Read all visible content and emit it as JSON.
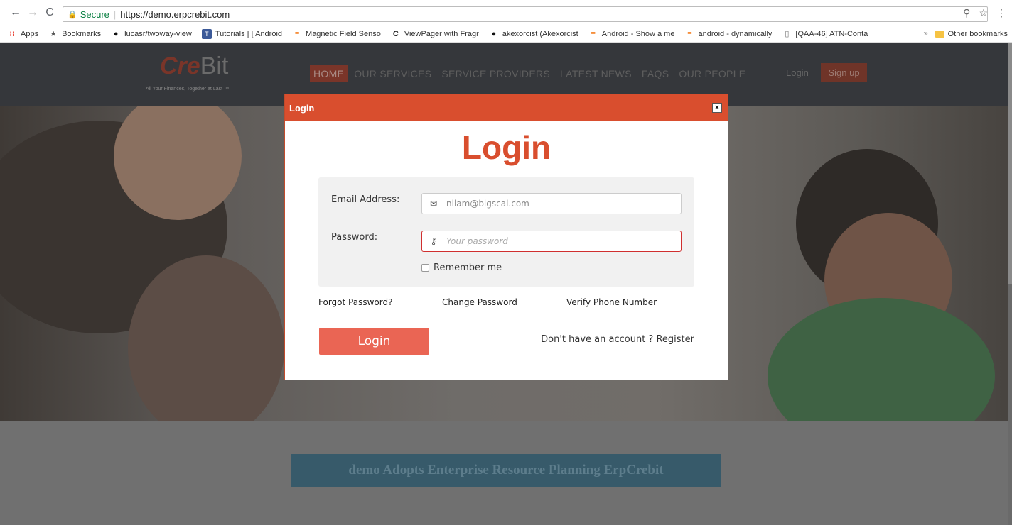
{
  "browser": {
    "secure_label": "Secure",
    "url": "https://demo.erpcrebit.com",
    "bookmarks": [
      {
        "label": "Apps",
        "icon": "apps-icon"
      },
      {
        "label": "Bookmarks",
        "icon": "star-icon"
      },
      {
        "label": "lucasr/twoway-view",
        "icon": "github-icon"
      },
      {
        "label": "Tutorials | [ Android",
        "icon": "tutorials-icon"
      },
      {
        "label": "Magnetic Field Senso",
        "icon": "stackoverflow-icon"
      },
      {
        "label": "ViewPager with Fragr",
        "icon": "codepath-icon"
      },
      {
        "label": "akexorcist (Akexorcist",
        "icon": "github-icon"
      },
      {
        "label": "Android - Show a me",
        "icon": "stackoverflow-icon"
      },
      {
        "label": "android - dynamically",
        "icon": "stackoverflow-icon"
      },
      {
        "label": "[QAA-46] ATN-Conta",
        "icon": "document-icon"
      }
    ],
    "overflow": "»",
    "other_bookmarks": "Other bookmarks"
  },
  "site": {
    "logo_text": "Cre",
    "logo_text_suffix": "Bit",
    "tagline": "All Your Finances, Together at Last ™",
    "nav": [
      "HOME",
      "OUR SERVICES",
      "SERVICE PROVIDERS",
      "LATEST NEWS",
      "FAQS",
      "OUR PEOPLE"
    ],
    "login": "Login",
    "signup": "Sign up",
    "banner": "demo Adopts Enterprise Resource Planning ErpCrebit"
  },
  "modal": {
    "header": "Login",
    "close": "×",
    "title": "Login",
    "email_label": "Email Address:",
    "email_value": "nilam@bigscal.com",
    "password_label": "Password:",
    "password_placeholder": "Your password",
    "remember": "Remember me",
    "forgot": "Forgot Password?",
    "change": "Change Password",
    "verify": "Verify Phone Number",
    "login_button": "Login",
    "no_account": "Don't have an account ? ",
    "register": "Register"
  },
  "colors": {
    "accent": "#d94e2e",
    "button": "#ea6554",
    "header_bg": "#35373b"
  }
}
